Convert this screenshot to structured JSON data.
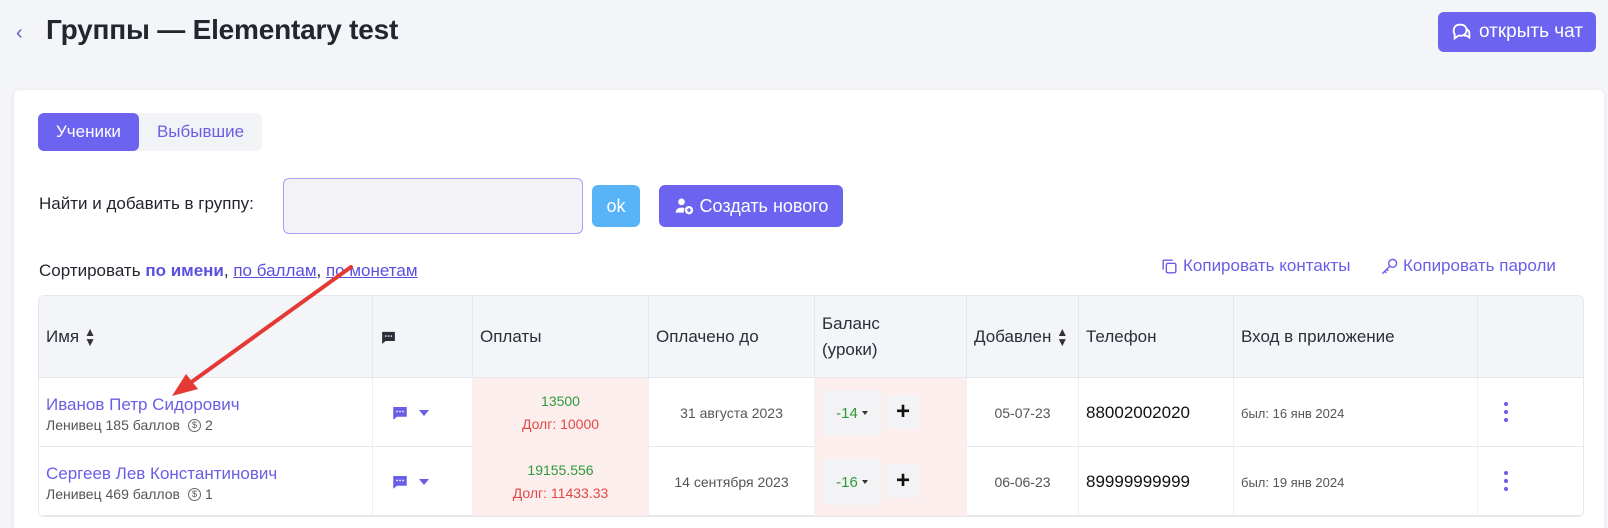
{
  "header": {
    "title": "Группы — Elementary test",
    "chat_button": "открыть чат"
  },
  "tabs": [
    {
      "label": "Ученики",
      "active": true
    },
    {
      "label": "Выбывшие",
      "active": false
    }
  ],
  "find": {
    "label": "Найти и добавить в группу:",
    "value": "",
    "ok_label": "ok",
    "create_label": "Создать нового"
  },
  "sort": {
    "prefix": "Сортировать",
    "by_name": "по имени",
    "by_points": "по баллам",
    "by_coins": "по монетам"
  },
  "actions": {
    "copy_contacts": "Копировать контакты",
    "copy_passwords": "Копировать пароли"
  },
  "table": {
    "headers": {
      "name": "Имя",
      "payments": "Оплаты",
      "paid_until": "Оплачено до",
      "balance_1": "Баланс",
      "balance_2": "(уроки)",
      "added": "Добавлен",
      "phone": "Телефон",
      "login": "Вход в приложение"
    },
    "rows": [
      {
        "name": "Иванов Петр Сидорович",
        "sub": "Ленивец 185 баллов",
        "coins": "2",
        "payment": "13500",
        "debt": "Долг: 10000",
        "paid_until": "31 августа 2023",
        "balance": "-14",
        "added": "05-07-23",
        "phone": "88002002020",
        "login": "был: 16 янв 2024"
      },
      {
        "name": "Сергеев Лев Константинович",
        "sub": "Ленивец 469 баллов",
        "coins": "1",
        "payment": "19155.556",
        "debt": "Долг: 11433.33",
        "paid_until": "14 сентября 2023",
        "balance": "-16",
        "added": "06-06-23",
        "phone": "89999999999",
        "login": "был: 19 янв 2024"
      }
    ]
  },
  "colors": {
    "accent": "#6c63f0",
    "link": "#6a5ee6",
    "ok": "#58b3f7",
    "positive": "#2f9a3a",
    "negative": "#e04848",
    "debt_bg": "#fdeeee",
    "annotation_arrow": "#e53935"
  }
}
